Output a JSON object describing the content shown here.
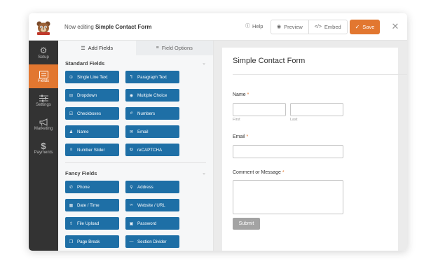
{
  "topbar": {
    "editing_prefix": "Now editing",
    "form_name": "Simple Contact Form",
    "help_label": "Help",
    "preview_label": "Preview",
    "embed_label": "Embed",
    "save_label": "Save"
  },
  "nav": {
    "items": [
      {
        "label": "Setup",
        "icon": "gear-icon"
      },
      {
        "label": "Fields",
        "icon": "fields-list-icon"
      },
      {
        "label": "Settings",
        "icon": "sliders-icon"
      },
      {
        "label": "Marketing",
        "icon": "megaphone-icon"
      },
      {
        "label": "Payments",
        "icon": "dollar-icon"
      }
    ]
  },
  "panel": {
    "tabs": [
      {
        "label": "Add Fields",
        "icon": "list-icon"
      },
      {
        "label": "Field Options",
        "icon": "sliders-icon"
      }
    ],
    "standard": {
      "title": "Standard Fields",
      "items": [
        {
          "label": "Single Line Text",
          "icon": "text-icon"
        },
        {
          "label": "Paragraph Text",
          "icon": "paragraph-icon"
        },
        {
          "label": "Dropdown",
          "icon": "dropdown-icon"
        },
        {
          "label": "Multiple Choice",
          "icon": "radio-icon"
        },
        {
          "label": "Checkboxes",
          "icon": "checkbox-icon"
        },
        {
          "label": "Numbers",
          "icon": "hash-icon"
        },
        {
          "label": "Name",
          "icon": "user-icon"
        },
        {
          "label": "Email",
          "icon": "envelope-icon"
        },
        {
          "label": "Number Slider",
          "icon": "slider-icon"
        },
        {
          "label": "reCAPTCHA",
          "icon": "google-icon"
        }
      ]
    },
    "fancy": {
      "title": "Fancy Fields",
      "items": [
        {
          "label": "Phone",
          "icon": "phone-icon"
        },
        {
          "label": "Address",
          "icon": "map-pin-icon"
        },
        {
          "label": "Date / Time",
          "icon": "calendar-icon"
        },
        {
          "label": "Website / URL",
          "icon": "link-icon"
        },
        {
          "label": "File Upload",
          "icon": "upload-icon"
        },
        {
          "label": "Password",
          "icon": "lock-icon"
        },
        {
          "label": "Page Break",
          "icon": "copy-icon"
        },
        {
          "label": "Section Divider",
          "icon": "divider-icon"
        }
      ]
    }
  },
  "form": {
    "title": "Simple Contact Form",
    "name_label": "Name",
    "first_label": "First",
    "last_label": "Last",
    "email_label": "Email",
    "message_label": "Comment or Message",
    "required_mark": "*",
    "submit_label": "Submit"
  },
  "colors": {
    "accent": "#e27730",
    "field_button": "#1e6fa6",
    "nav_bg": "#333333"
  }
}
